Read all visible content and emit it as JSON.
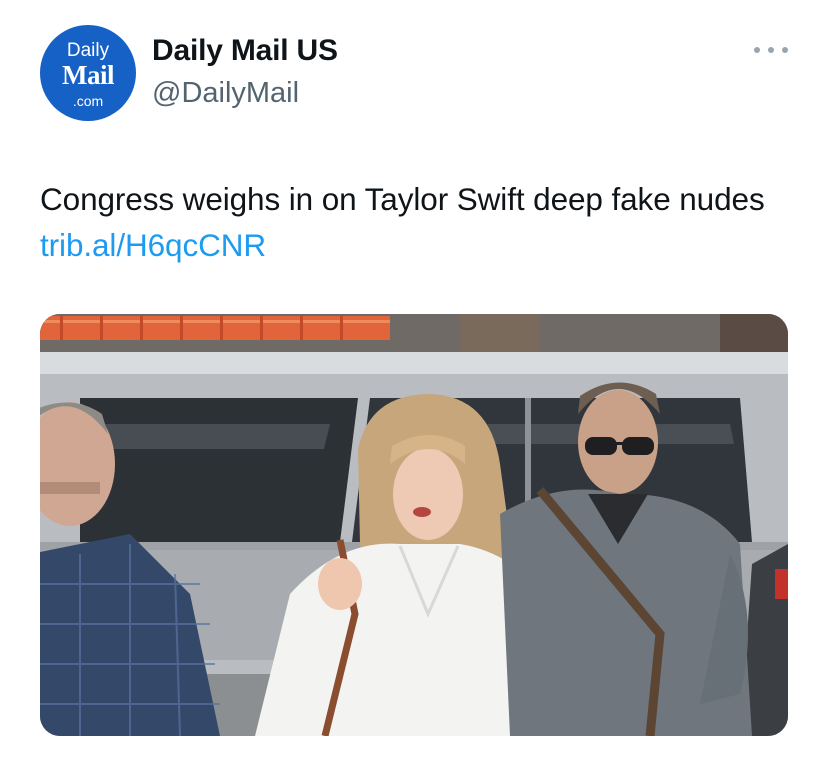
{
  "account": {
    "avatar_logo": {
      "line1": "Daily",
      "line2": "Mail",
      "line3": ".com"
    },
    "display_name": "Daily Mail US",
    "handle": "@DailyMail"
  },
  "tweet": {
    "text": "Congress weighs in on Taylor Swift deep fake nudes ",
    "link": "trib.al/H6qcCNR"
  },
  "media": {
    "icon": "photo"
  },
  "colors": {
    "link": "#1d9bf0",
    "avatar_bg": "#1661c6",
    "secondary_text": "#536471"
  },
  "icons": {
    "more": "more-horizontal-icon"
  }
}
